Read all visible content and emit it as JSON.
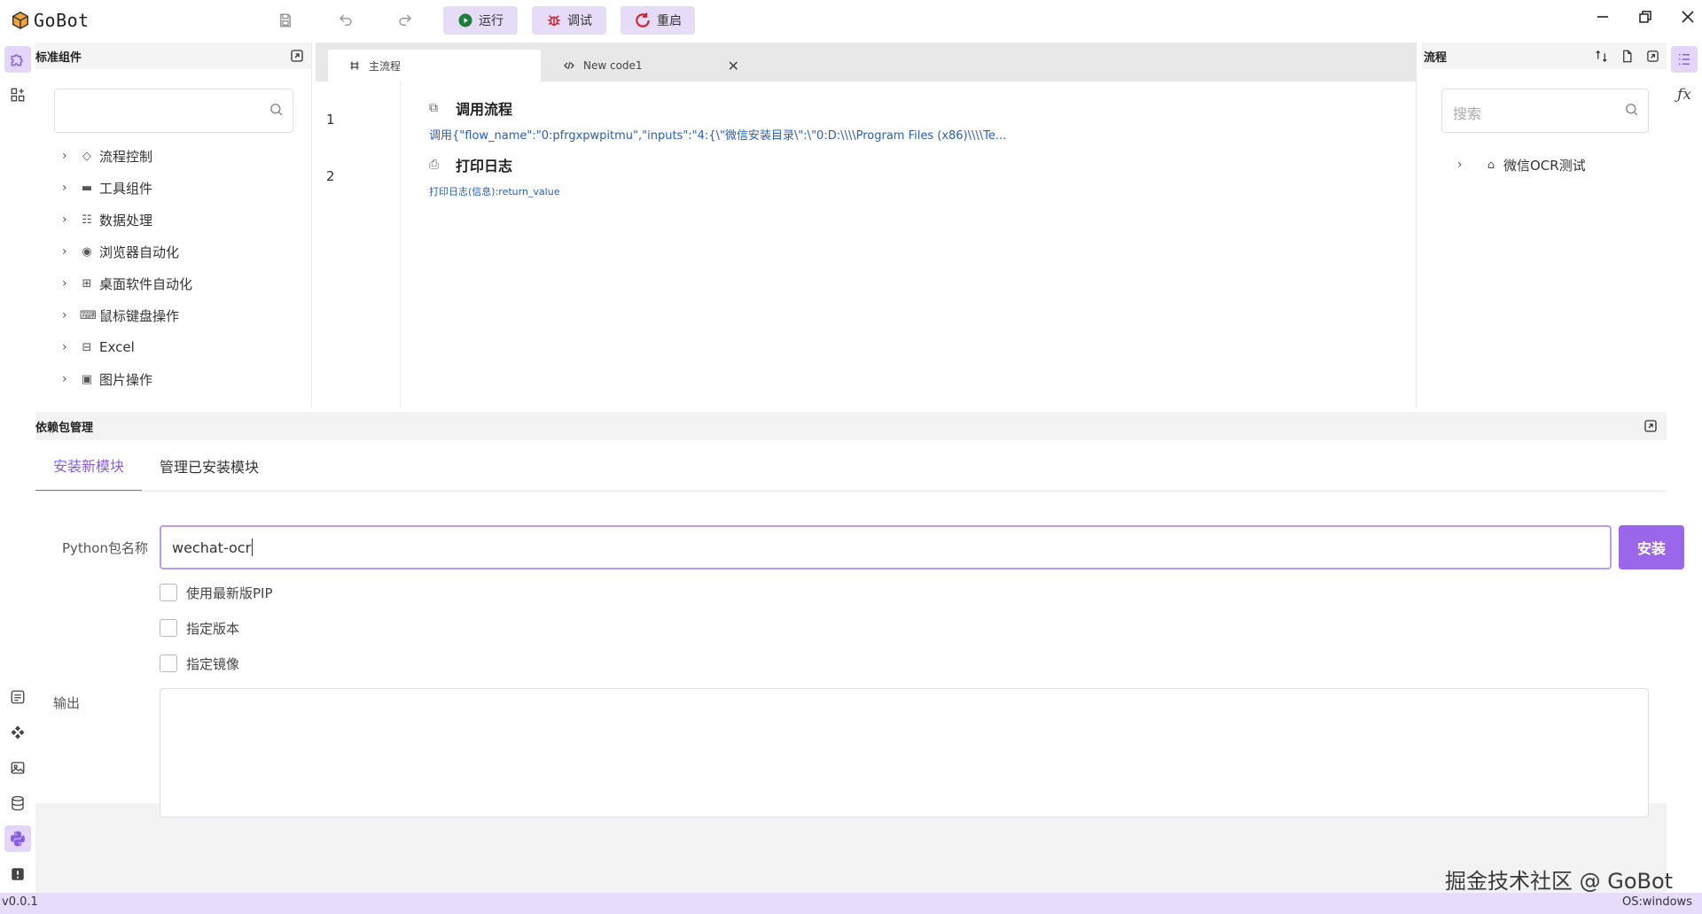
{
  "app": {
    "title": "GoBot"
  },
  "toolbar": {
    "run_label": "运行",
    "debug_label": "调试",
    "restart_label": "重启"
  },
  "colors": {
    "accent": "#9a66ea",
    "accent_light": "#e6dcf8",
    "status_bar": "#e7dcfa"
  },
  "left_panel": {
    "title": "标准组件",
    "search_placeholder": "",
    "items": [
      {
        "label": "流程控制",
        "icon": "diamond-icon"
      },
      {
        "label": "工具组件",
        "icon": "toolbox-icon"
      },
      {
        "label": "数据处理",
        "icon": "data-icon"
      },
      {
        "label": "浏览器自动化",
        "icon": "chrome-icon"
      },
      {
        "label": "桌面软件自动化",
        "icon": "windows-icon"
      },
      {
        "label": "鼠标键盘操作",
        "icon": "keyboard-icon"
      },
      {
        "label": "Excel",
        "icon": "excel-icon"
      },
      {
        "label": "图片操作",
        "icon": "image-icon"
      }
    ]
  },
  "editor": {
    "tabs": [
      {
        "label": "主流程"
      },
      {
        "label": "New code1"
      }
    ],
    "steps": [
      {
        "line": "1",
        "title": "调用流程",
        "desc": "调用{\"flow_name\":\"0:pfrgxpwpitmu\",\"inputs\":\"4:{\\\"微信安装目录\\\":\\\"0:D:\\\\\\\\Program Files (x86)\\\\\\\\Te..."
      },
      {
        "line": "2",
        "title": "打印日志",
        "desc": "打印日志(信息):return_value"
      }
    ]
  },
  "right_panel": {
    "title": "流程",
    "search_placeholder": "搜索",
    "items": [
      {
        "label": "微信OCR测试"
      }
    ]
  },
  "package_panel": {
    "title": "依赖包管理",
    "tabs": [
      {
        "label": "安装新模块"
      },
      {
        "label": "管理已安装模块"
      }
    ],
    "name_label": "Python包名称",
    "name_value": "wechat-ocr",
    "install_label": "安装",
    "options": [
      {
        "label": "使用最新版PIP"
      },
      {
        "label": "指定版本"
      },
      {
        "label": "指定镜像"
      }
    ],
    "output_label": "输出",
    "output_value": ""
  },
  "status": {
    "version": "v0.0.1",
    "os": "OS:windows"
  },
  "watermark": "掘金技术社区 @ GoBot"
}
